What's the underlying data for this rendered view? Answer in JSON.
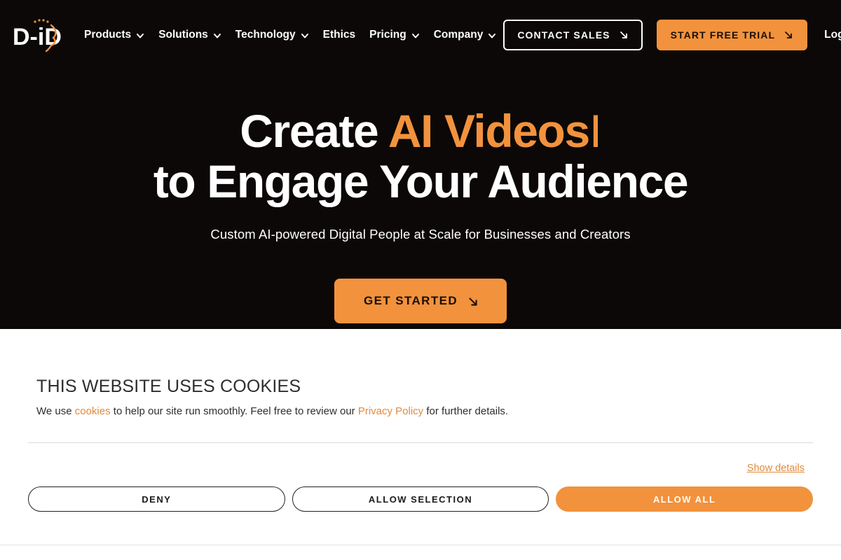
{
  "brand": {
    "logo_text": "D-iD",
    "accent_color": "#F2923D",
    "hero_background": "#0c0807"
  },
  "nav": {
    "items": [
      {
        "label": "Products",
        "has_chevron": true
      },
      {
        "label": "Solutions",
        "has_chevron": true
      },
      {
        "label": "Technology",
        "has_chevron": true
      },
      {
        "label": "Ethics",
        "has_chevron": false
      },
      {
        "label": "Pricing",
        "has_chevron": true
      },
      {
        "label": "Company",
        "has_chevron": true
      }
    ],
    "contact_sales": "CONTACT SALES",
    "start_free_trial": "START FREE TRIAL",
    "login": "Log in"
  },
  "hero": {
    "headline_line1_static": "Create ",
    "headline_line1_accent": "AI Videos",
    "headline_caret": "I",
    "headline_line2": "to Engage Your Audience",
    "subheadline": "Custom AI-powered Digital People at Scale for Businesses and Creators",
    "cta": "GET STARTED"
  },
  "cookie_banner": {
    "title": "THIS WEBSITE USES COOKIES",
    "text_part1": "We use ",
    "link_cookies": "cookies",
    "text_part2": " to help our site run smoothly. Feel free to review our ",
    "link_privacy": "Privacy Policy",
    "text_part3": " for further details.",
    "show_details": "Show details",
    "deny": "DENY",
    "allow_selection": "ALLOW SELECTION",
    "allow_all": "ALLOW ALL"
  }
}
